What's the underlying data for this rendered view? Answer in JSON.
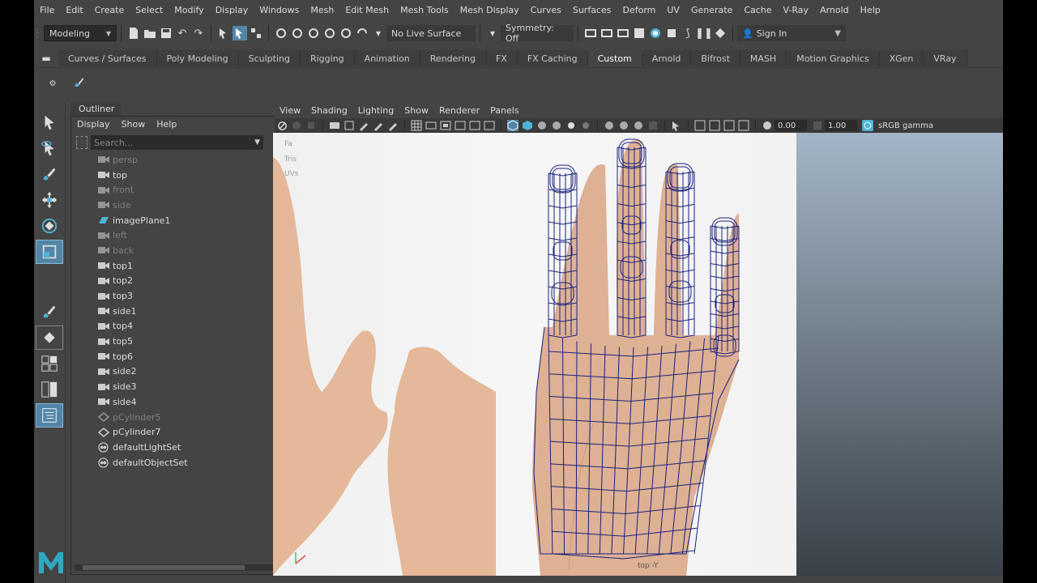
{
  "menubar": [
    "File",
    "Edit",
    "Create",
    "Select",
    "Modify",
    "Display",
    "Windows",
    "Mesh",
    "Edit Mesh",
    "Mesh Tools",
    "Mesh Display",
    "Curves",
    "Surfaces",
    "Deform",
    "UV",
    "Generate",
    "Cache",
    "V-Ray",
    "Arnold",
    "Help"
  ],
  "statusline": {
    "mode": "Modeling",
    "live_surface": "No Live Surface",
    "symmetry": "Symmetry: Off",
    "sign_in": "Sign In"
  },
  "shelf_tabs": [
    "Curves / Surfaces",
    "Poly Modeling",
    "Sculpting",
    "Rigging",
    "Animation",
    "Rendering",
    "FX",
    "FX Caching",
    "Custom",
    "Arnold",
    "Bifrost",
    "MASH",
    "Motion Graphics",
    "XGen",
    "VRay"
  ],
  "shelf_active": "Custom",
  "outliner": {
    "tab": "Outliner",
    "menu": [
      "Display",
      "Show",
      "Help"
    ],
    "search_placeholder": "Search...",
    "items": [
      {
        "label": "persp",
        "icon": "camera-icon",
        "dim": true
      },
      {
        "label": "top",
        "icon": "camera-icon",
        "dim": false
      },
      {
        "label": "front",
        "icon": "camera-icon",
        "dim": true
      },
      {
        "label": "side",
        "icon": "camera-icon",
        "dim": true
      },
      {
        "label": "imagePlane1",
        "icon": "image-plane-icon",
        "dim": false
      },
      {
        "label": "left",
        "icon": "camera-icon",
        "dim": true
      },
      {
        "label": "back",
        "icon": "camera-icon",
        "dim": true
      },
      {
        "label": "top1",
        "icon": "camera-icon",
        "dim": false
      },
      {
        "label": "top2",
        "icon": "camera-icon",
        "dim": false
      },
      {
        "label": "top3",
        "icon": "camera-icon",
        "dim": false
      },
      {
        "label": "side1",
        "icon": "camera-icon",
        "dim": false
      },
      {
        "label": "top4",
        "icon": "camera-icon",
        "dim": false
      },
      {
        "label": "top5",
        "icon": "camera-icon",
        "dim": false
      },
      {
        "label": "top6",
        "icon": "camera-icon",
        "dim": false
      },
      {
        "label": "side2",
        "icon": "camera-icon",
        "dim": false
      },
      {
        "label": "side3",
        "icon": "camera-icon",
        "dim": false
      },
      {
        "label": "side4",
        "icon": "camera-icon",
        "dim": false
      },
      {
        "label": "pCylinder5",
        "icon": "mesh-icon",
        "dim": true
      },
      {
        "label": "pCylinder7",
        "icon": "mesh-icon",
        "dim": false
      },
      {
        "label": "defaultLightSet",
        "icon": "set-icon",
        "dim": false
      },
      {
        "label": "defaultObjectSet",
        "icon": "set-icon",
        "dim": false
      }
    ]
  },
  "panel_menu": [
    "View",
    "Shading",
    "Lighting",
    "Show",
    "Renderer",
    "Panels"
  ],
  "panel_tools": {
    "exposure": "0.00",
    "gamma": "1.00",
    "color_space": "sRGB gamma"
  },
  "viewport": {
    "hud_labels": [
      "",
      "",
      "Fa",
      "Tris",
      "UVs"
    ],
    "camera_label": "top -Y"
  },
  "colors": {
    "accent": "#5285a6",
    "wire": "#1a237e",
    "ui_bg": "#444444"
  }
}
